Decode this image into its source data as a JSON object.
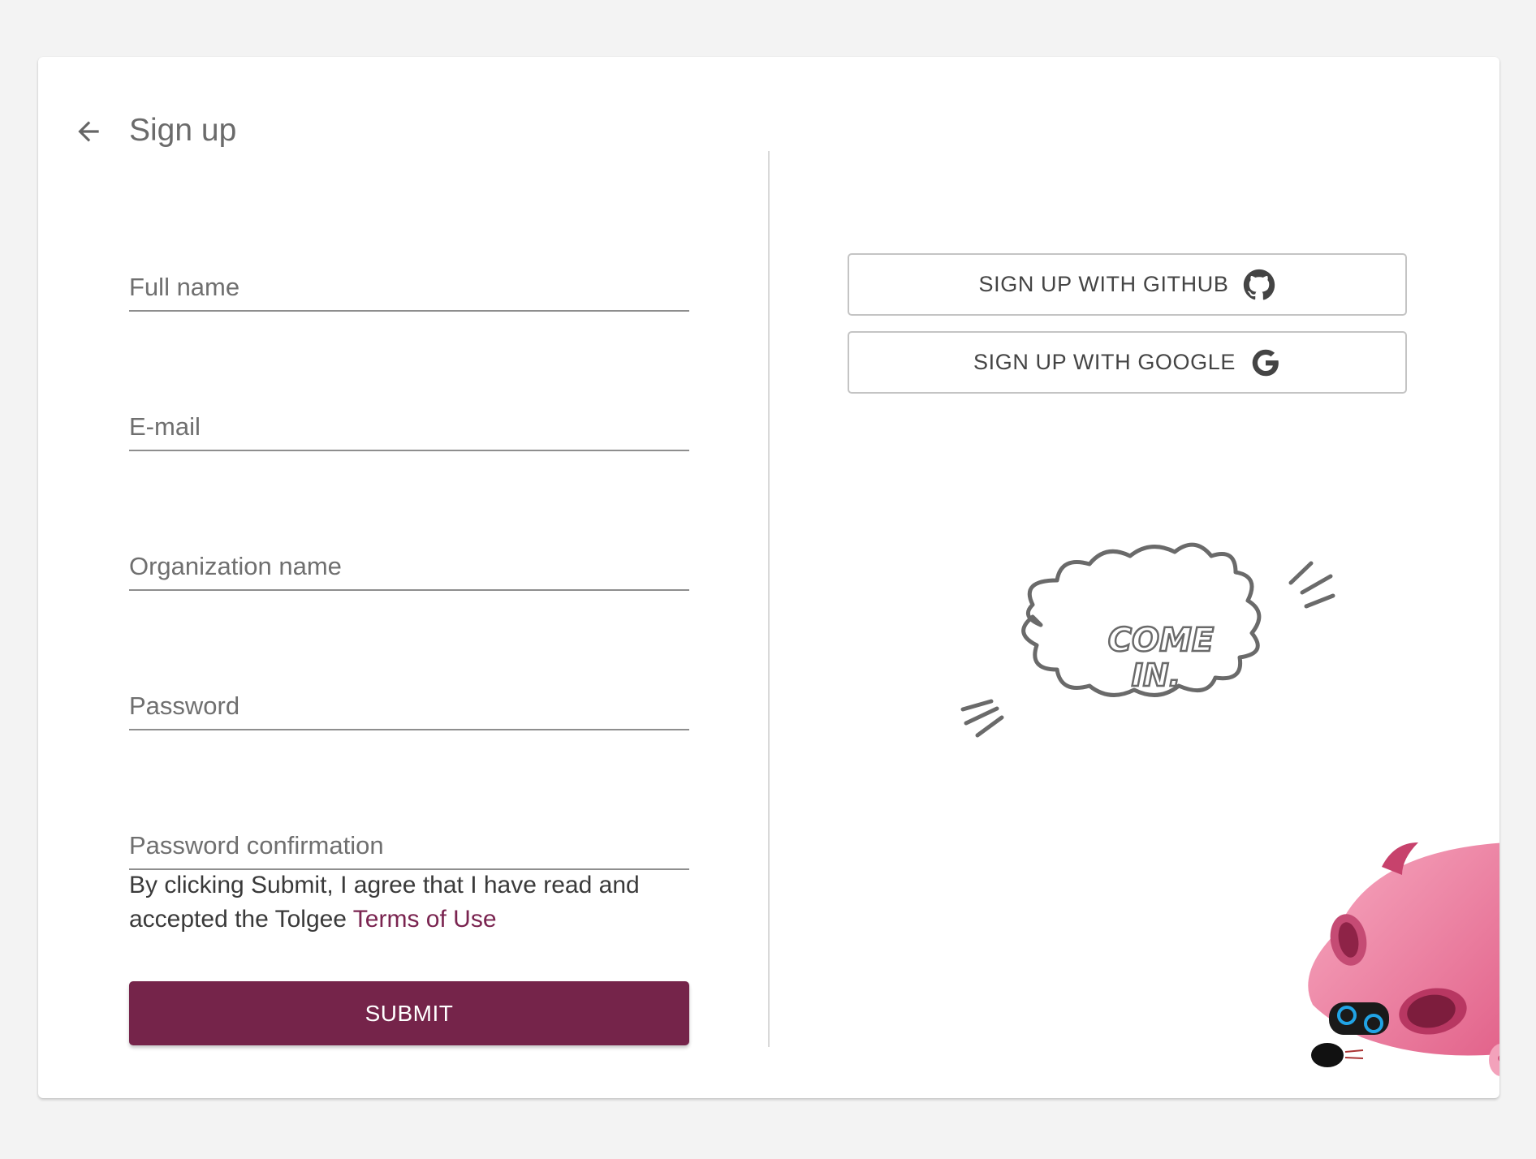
{
  "page": {
    "title": "Sign up"
  },
  "form": {
    "full_name_placeholder": "Full name",
    "email_placeholder": "E-mail",
    "organization_placeholder": "Organization name",
    "password_placeholder": "Password",
    "password_confirmation_placeholder": "Password confirmation",
    "terms_text": "By clicking Submit, I agree that I have read and accepted the Tolgee ",
    "terms_link": "Terms of Use",
    "submit_label": "SUBMIT"
  },
  "oauth": {
    "github_label": "SIGN UP WITH GITHUB",
    "google_label": "SIGN UP WITH GOOGLE"
  },
  "illustration": {
    "bubble_text_line1": "COME",
    "bubble_text_line2": "IN."
  },
  "colors": {
    "primary": "#75244a",
    "link": "#7a2450",
    "background": "#f3f3f3",
    "card": "#ffffff"
  }
}
